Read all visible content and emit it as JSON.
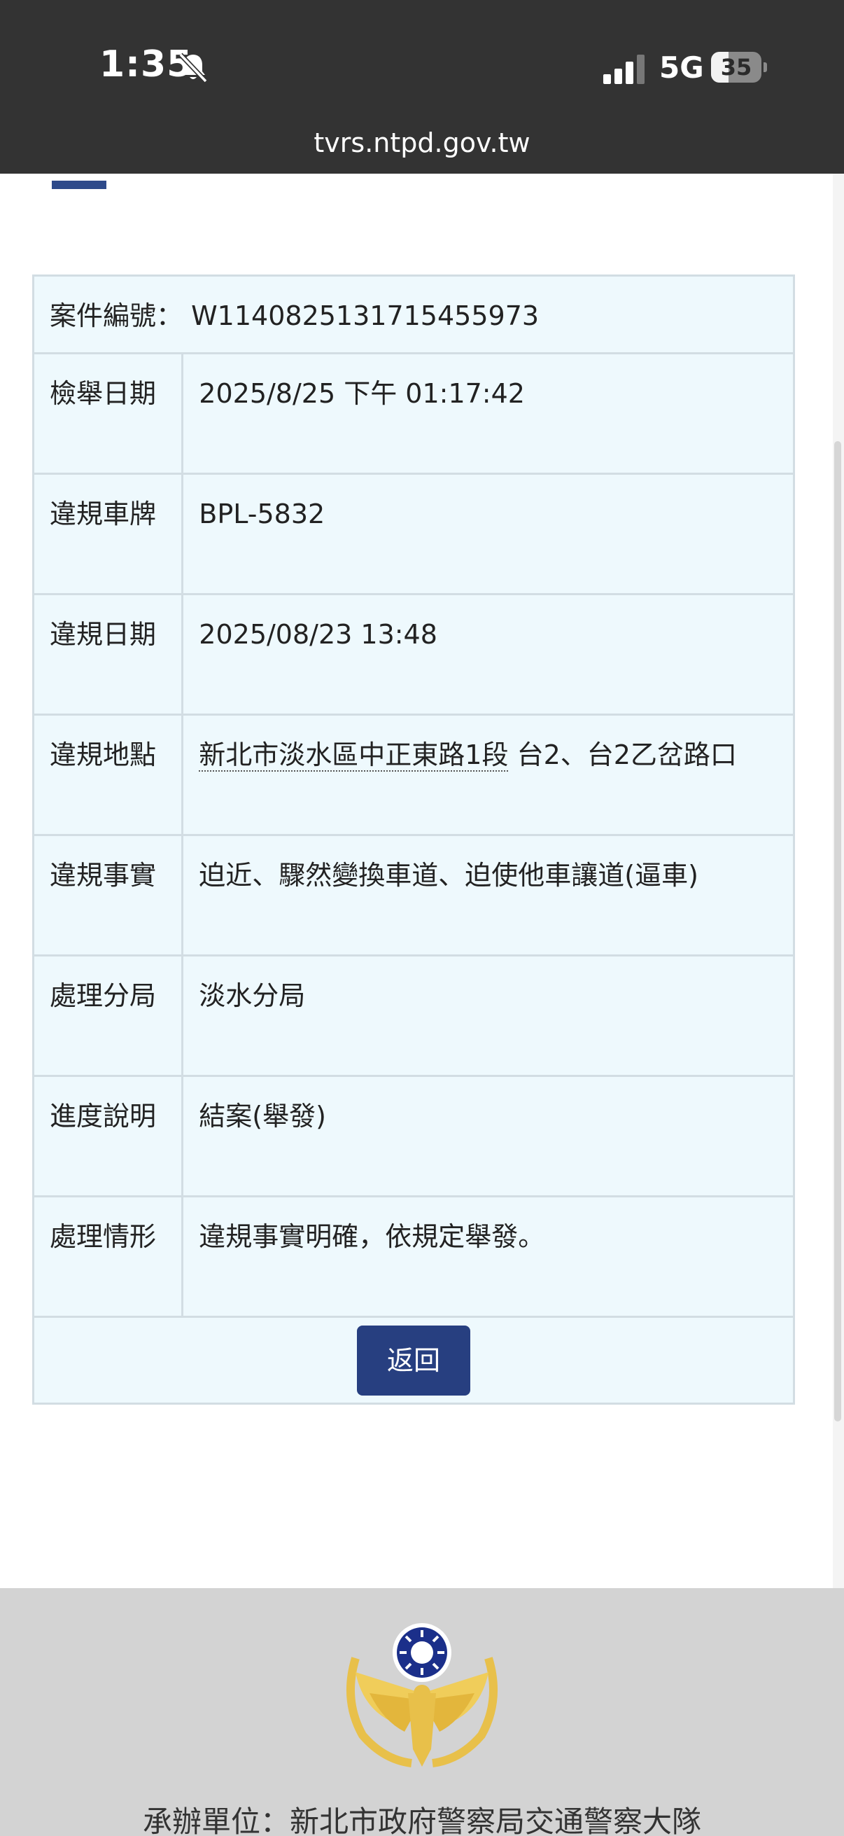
{
  "status_bar": {
    "time": "1:35",
    "network": "5G",
    "battery_level": "35",
    "battery_fraction": 0.35,
    "url": "tvrs.ntpd.gov.tw"
  },
  "case": {
    "label": "案件編號：",
    "number": "W1140825131715455973"
  },
  "fields": [
    {
      "label": "檢舉日期",
      "value": "2025/8/25 下午 01:17:42"
    },
    {
      "label": "違規車牌",
      "value": "BPL-5832"
    },
    {
      "label": "違規日期",
      "value": "2025/08/23 13:48"
    },
    {
      "label": "違規地點",
      "value_linked": "新北市淡水區中正東路1段",
      "value_rest": " 台2、台2乙岔路口"
    },
    {
      "label": "違規事實",
      "value": "迫近、驟然變換車道、迫使他車讓道(逼車)"
    },
    {
      "label": "處理分局",
      "value": "淡水分局"
    },
    {
      "label": "進度說明",
      "value": "結案(舉發)"
    },
    {
      "label": "處理情形",
      "value": "違規事實明確，依規定舉發。"
    }
  ],
  "back_button_label": "返回",
  "footer": {
    "text": "承辦單位：新北市政府警察局交通警察大隊"
  },
  "colors": {
    "status_bar": "#333333",
    "table_background": "#eef9fd",
    "table_border": "#d2dde3",
    "button": "#273f80",
    "accent": "#2e4a8a",
    "footer": "#d3d3d3",
    "emblem_gold": "#e8c04a",
    "emblem_blue": "#1b2f8a"
  },
  "icons": {
    "bell": "bell-slash-icon",
    "signal": "cellular-signal-icon",
    "battery": "battery-icon",
    "emblem": "police-emblem-icon"
  }
}
